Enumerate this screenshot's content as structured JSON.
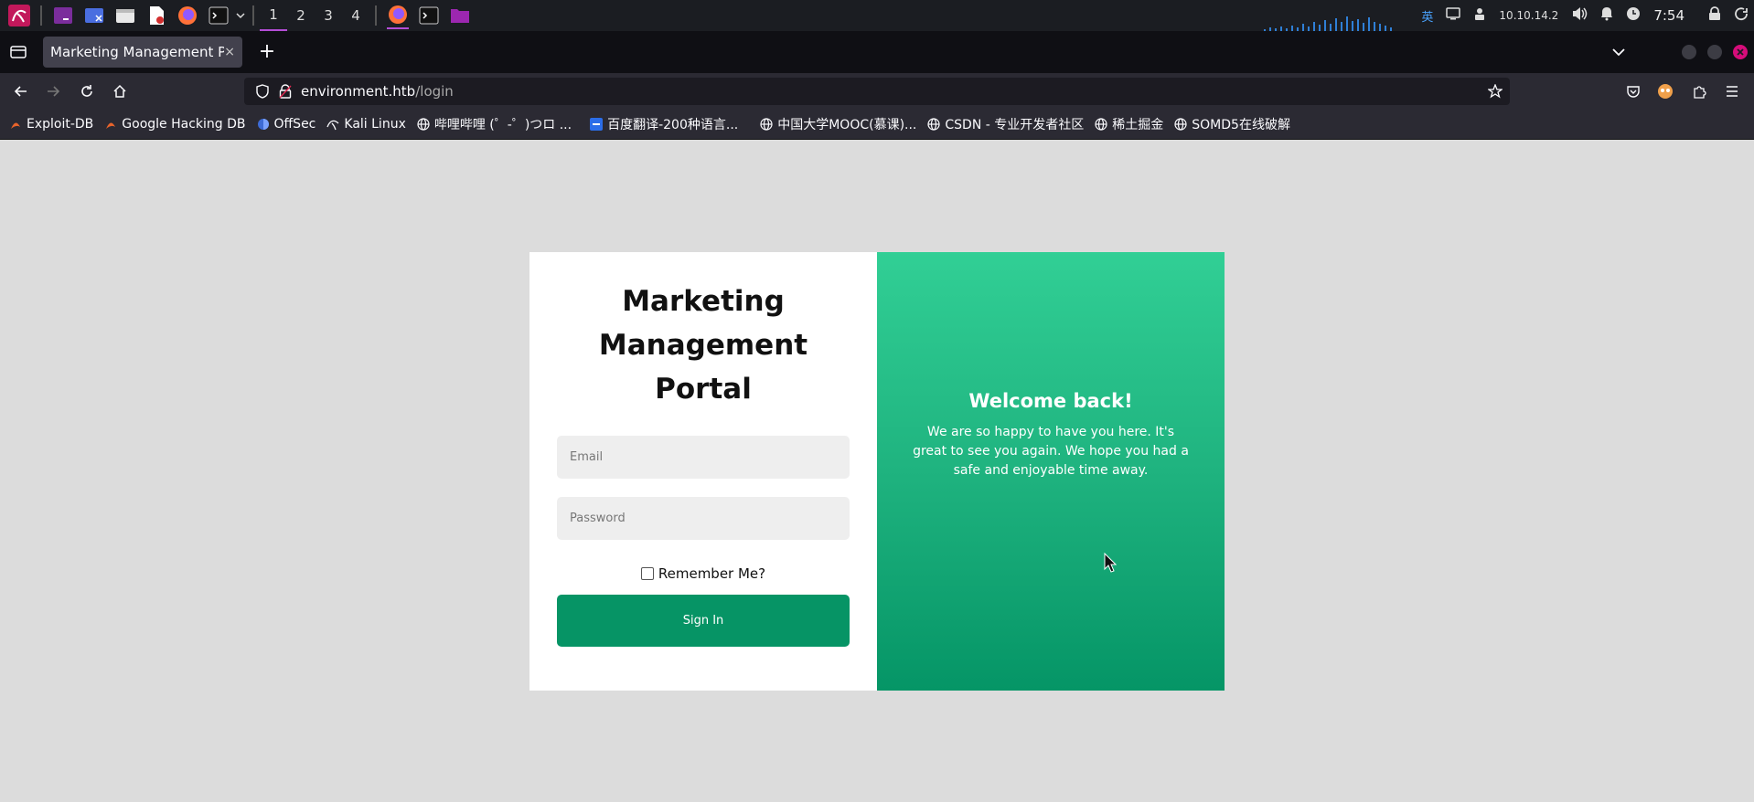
{
  "os_panel": {
    "workspaces": [
      "1",
      "2",
      "3",
      "4"
    ],
    "active_workspace": "1",
    "ime": "英",
    "ip": "10.10.14.2",
    "clock": "7:54"
  },
  "browser": {
    "tab": {
      "title": "Marketing Management Portal",
      "close": "×"
    },
    "new_tab": "+",
    "url": {
      "host": "environment.htb",
      "path": "/login"
    },
    "bookmarks": [
      {
        "label": "Exploit-DB",
        "icon": "exploitdb-icon"
      },
      {
        "label": "Google Hacking DB",
        "icon": "ghdb-icon"
      },
      {
        "label": "OffSec",
        "icon": "offsec-icon"
      },
      {
        "label": "Kali Linux",
        "icon": "kali-icon"
      },
      {
        "label": "哔哩哔哩 (゜-゜)つロ ...",
        "icon": "globe-icon"
      },
      {
        "label": "百度翻译-200种语言...",
        "icon": "baidu-translate-icon"
      },
      {
        "label": "中国大学MOOC(慕课)...",
        "icon": "globe-icon"
      },
      {
        "label": "CSDN - 专业开发者社区",
        "icon": "globe-icon"
      },
      {
        "label": "稀土掘金",
        "icon": "globe-icon"
      },
      {
        "label": "SOMD5在线破解",
        "icon": "globe-icon"
      }
    ]
  },
  "login": {
    "title": "Marketing Management Portal",
    "email_placeholder": "Email",
    "password_placeholder": "Password",
    "remember_label": "Remember Me?",
    "signin_label": "Sign In"
  },
  "welcome": {
    "heading": "Welcome back!",
    "message": "We are so happy to have you here. It's great to see you again. We hope you had a safe and enjoyable time away."
  },
  "colors": {
    "primary_button": "#069465",
    "gradient_top": "#31cf95",
    "gradient_bottom": "#059566",
    "page_background": "#dcdcdc"
  }
}
